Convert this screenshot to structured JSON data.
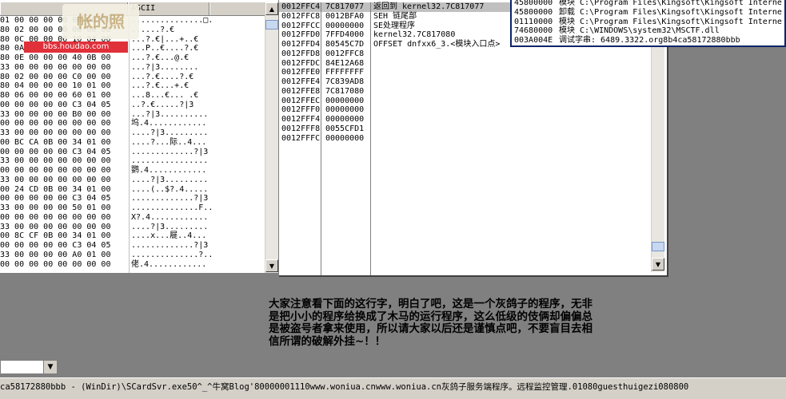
{
  "dump": {
    "header_ascii": "ASCII",
    "hex_rows": [
      "01 00 00 00 00 00 00 00",
      "80 02 00 00 00 00 00 00",
      "80 0C 00 00 00 10 04 00",
      "80 0A 00 00 00 00 00 00",
      "80 0E 00 00 00 40 0B 00",
      "33 00 00 00 00 00 00 00",
      "80 02 00 00 00 C0 00 00",
      "80 04 00 00 00 10 01 00",
      "80 06 00 00 00 60 01 00",
      "00 00 00 00 00 C3 04 05",
      "33 00 00 00 00 B0 00 00",
      "00 00 00 00 00 00 00 00",
      "33 00 00 00 00 00 00 00",
      "00 BC CA 0B 00 34 01 00",
      "00 00 00 00 00 C3 04 05",
      "33 00 00 00 00 00 00 00",
      "00 00 00 00 00 00 00 00",
      "33 00 00 00 00 00 00 00",
      "00 24 CD 0B 00 34 01 00",
      "00 00 00 00 00 C3 04 05",
      "33 00 00 00 00 50 01 00",
      "00 00 00 00 00 00 00 00",
      "33 00 00 00 00 00 00 00",
      "00 8C CF 0B 00 34 01 00",
      "00 00 00 00 00 C3 04 05",
      "33 00 00 00 00 A0 01 00",
      "00 00 00 00 00 00 00 00"
    ],
    "ascii_rows": [
      "...............□.",
      "......?.€",
      "...?.€|...+..€",
      "...P..€....?.€",
      "...?.€...@.€",
      "...?|3........",
      "...?.€....?.€",
      "...?.€...+.€",
      "...8...€... .€",
      "..?.€.....?|3",
      "...?|3..........",
      "坞.4............",
      "....?|3.........",
      "....?...际..4...",
      ".............?|3",
      "................",
      "鹦.4............",
      "....?|3.........",
      "....(..$?.4.....",
      ".............?|3",
      "..............F..",
      "X?.4............",
      "....?|3.........",
      "....x...屣..4...",
      ".............?|3",
      "..............?..",
      "佬.4............"
    ]
  },
  "stack": {
    "rows": [
      {
        "addr": "0012FFC4",
        "value": "7C817077",
        "comment": "返回到 kernel32.7C817077"
      },
      {
        "addr": "0012FFC8",
        "value": "0012BFA0",
        "comment": ""
      },
      {
        "addr": "0012FFCC",
        "value": "00000000",
        "comment": ""
      },
      {
        "addr": "0012FFD0",
        "value": "7FFD4000",
        "comment": ""
      },
      {
        "addr": "0012FFD4",
        "value": "80545C7D",
        "comment": ""
      },
      {
        "addr": "0012FFD8",
        "value": "0012FFC8",
        "comment": ""
      },
      {
        "addr": "0012FFDC",
        "value": "84E12A68",
        "comment": ""
      },
      {
        "addr": "0012FFE0",
        "value": "FFFFFFFF",
        "comment": "SEH 链尾部"
      },
      {
        "addr": "0012FFE4",
        "value": "7C839AD8",
        "comment": "SE处理程序"
      },
      {
        "addr": "0012FFE8",
        "value": "7C817080",
        "comment": "kernel32.7C817080"
      },
      {
        "addr": "0012FFEC",
        "value": "00000000",
        "comment": ""
      },
      {
        "addr": "0012FFF0",
        "value": "00000000",
        "comment": ""
      },
      {
        "addr": "0012FFF4",
        "value": "00000000",
        "comment": ""
      },
      {
        "addr": "0012FFF8",
        "value": "0055CFD1",
        "comment": "OFFSET dnfxx6_3.<模块入口点>"
      },
      {
        "addr": "0012FFFC",
        "value": "00000000",
        "comment": ""
      }
    ]
  },
  "log": {
    "rows": [
      {
        "addr": "45800000",
        "text": "模块 C:\\Program Files\\Kingsoft\\Kingsoft Interne"
      },
      {
        "addr": "45800000",
        "text": "卸载 C:\\Program Files\\Kingsoft\\Kingsoft Interne"
      },
      {
        "addr": "01110000",
        "text": "模块 C:\\Program Files\\Kingsoft\\Kingsoft Interne"
      },
      {
        "addr": "74680000",
        "text": "模块 C:\\WINDOWS\\system32\\MSCTF.dll"
      },
      {
        "addr": "003A004E",
        "text": "调试字串: 6489.3322.org8b4ca58172880bbb"
      }
    ]
  },
  "watermark": {
    "badge": "帐的照",
    "url": "bbs.houdao.com"
  },
  "annotation": {
    "lines": [
      "大家注意看下面的这行字，明白了吧，这是一个灰鸽子的程序，无非",
      "是把小小的程序给换成了木马的运行程序，这么低级的伎俩却偏偏总",
      "是被盗号者拿来使用，所以请大家以后还是谨慎点吧，不要盲目去相",
      "信所谓的破解外挂~！！"
    ]
  },
  "status": {
    "text": "ca58172880bbb - (WinDir)\\SCardSvr.exe50^_^牛窝Blog'80000001110www.woniua.cnwww.woniua.cn灰鸽子服务端程序。远程监控管理.01080guesthuigezi080800"
  },
  "icons": {
    "scroll_up": "▲",
    "scroll_down": "▼",
    "combo_arrow": "▼"
  }
}
